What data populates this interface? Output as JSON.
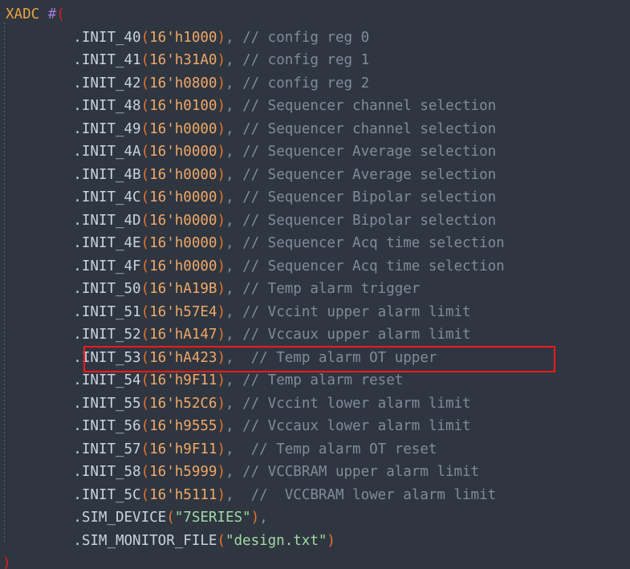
{
  "editor": {
    "background_color": "#2f3640",
    "language": "verilog",
    "highlight_color": "#ff1a1a"
  },
  "colors": {
    "module_name": "#e8a33d",
    "hash": "#9b7fd4",
    "red_paren": "#e01b1b",
    "port_name": "#c8d2e0",
    "punctuation": "#e8742c",
    "comma": "#7f8fa6",
    "number": "#f0a868",
    "comment": "#7f8c9b",
    "string": "#a3d9a5"
  },
  "header": {
    "module": "XADC",
    "hash": "#",
    "open_paren": "("
  },
  "footer": {
    "close_paren": ")"
  },
  "indent": "        ",
  "lines": [
    {
      "port": ".INIT_40",
      "value": "16'h1000",
      "sep": ", ",
      "comment": "// config reg 0"
    },
    {
      "port": ".INIT_41",
      "value": "16'h31A0",
      "sep": ", ",
      "comment": "// config reg 1"
    },
    {
      "port": ".INIT_42",
      "value": "16'h0800",
      "sep": ", ",
      "comment": "// config reg 2"
    },
    {
      "port": ".INIT_48",
      "value": "16'h0100",
      "sep": ", ",
      "comment": "// Sequencer channel selection"
    },
    {
      "port": ".INIT_49",
      "value": "16'h0000",
      "sep": ", ",
      "comment": "// Sequencer channel selection"
    },
    {
      "port": ".INIT_4A",
      "value": "16'h0000",
      "sep": ", ",
      "comment": "// Sequencer Average selection"
    },
    {
      "port": ".INIT_4B",
      "value": "16'h0000",
      "sep": ", ",
      "comment": "// Sequencer Average selection"
    },
    {
      "port": ".INIT_4C",
      "value": "16'h0000",
      "sep": ", ",
      "comment": "// Sequencer Bipolar selection"
    },
    {
      "port": ".INIT_4D",
      "value": "16'h0000",
      "sep": ", ",
      "comment": "// Sequencer Bipolar selection"
    },
    {
      "port": ".INIT_4E",
      "value": "16'h0000",
      "sep": ", ",
      "comment": "// Sequencer Acq time selection"
    },
    {
      "port": ".INIT_4F",
      "value": "16'h0000",
      "sep": ", ",
      "comment": "// Sequencer Acq time selection"
    },
    {
      "port": ".INIT_50",
      "value": "16'hA19B",
      "sep": ", ",
      "comment": "// Temp alarm trigger"
    },
    {
      "port": ".INIT_51",
      "value": "16'h57E4",
      "sep": ", ",
      "comment": "// Vccint upper alarm limit"
    },
    {
      "port": ".INIT_52",
      "value": "16'hA147",
      "sep": ", ",
      "comment": "// Vccaux upper alarm limit"
    },
    {
      "port": ".INIT_53",
      "value": "16'hA423",
      "sep": ",  ",
      "comment": "// Temp alarm OT upper",
      "highlighted": true
    },
    {
      "port": ".INIT_54",
      "value": "16'h9F11",
      "sep": ", ",
      "comment": "// Temp alarm reset"
    },
    {
      "port": ".INIT_55",
      "value": "16'h52C6",
      "sep": ", ",
      "comment": "// Vccint lower alarm limit"
    },
    {
      "port": ".INIT_56",
      "value": "16'h9555",
      "sep": ", ",
      "comment": "// Vccaux lower alarm limit"
    },
    {
      "port": ".INIT_57",
      "value": "16'h9F11",
      "sep": ",  ",
      "comment": "// Temp alarm OT reset"
    },
    {
      "port": ".INIT_58",
      "value": "16'h5999",
      "sep": ", ",
      "comment": "// VCCBRAM upper alarm limit"
    },
    {
      "port": ".INIT_5C",
      "value": "16'h5111",
      "sep": ",  ",
      "comment": "//  VCCBRAM lower alarm limit"
    },
    {
      "port": ".SIM_DEVICE",
      "string_value": "\"7SERIES\"",
      "sep": ",",
      "comment": ""
    },
    {
      "port": ".SIM_MONITOR_FILE",
      "string_value": "\"design.txt\"",
      "sep": "",
      "comment": ""
    }
  ]
}
